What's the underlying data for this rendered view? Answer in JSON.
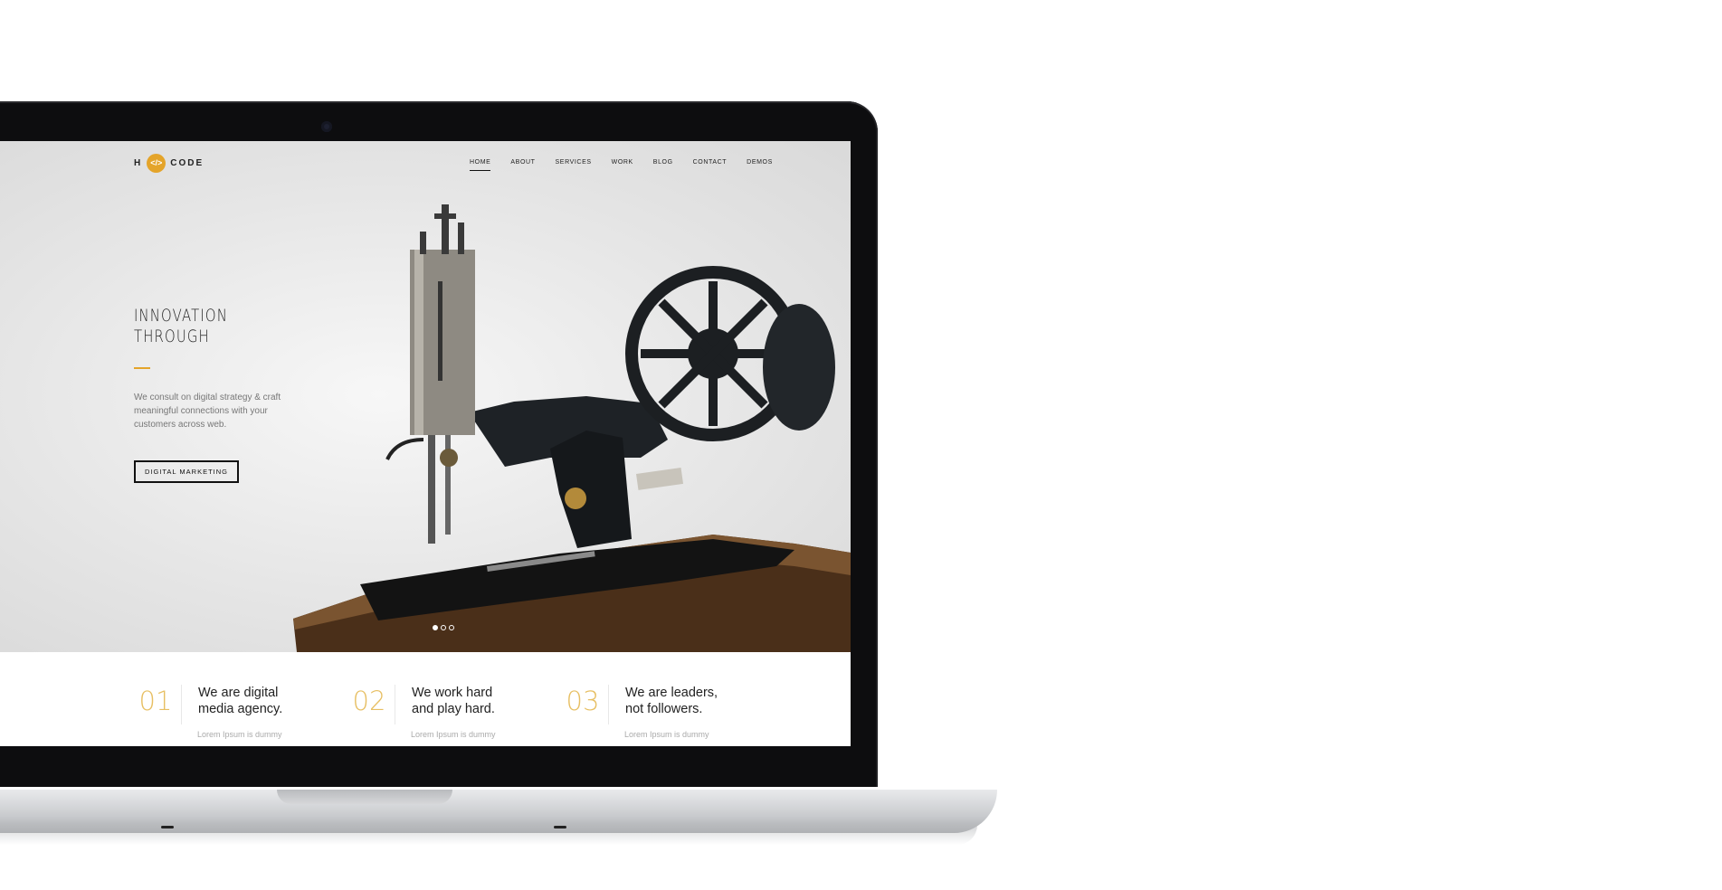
{
  "site": {
    "logo": {
      "left": "H",
      "badge": "</>",
      "right": "CODE"
    },
    "nav": [
      {
        "label": "HOME",
        "active": true
      },
      {
        "label": "ABOUT",
        "active": false
      },
      {
        "label": "SERVICES",
        "active": false
      },
      {
        "label": "WORK",
        "active": false
      },
      {
        "label": "BLOG",
        "active": false
      },
      {
        "label": "CONTACT",
        "active": false
      },
      {
        "label": "DEMOS",
        "active": false
      }
    ],
    "hero": {
      "headline_line1": "INNOVATION",
      "headline_line2": "THROUGH",
      "tagline": "We consult on digital strategy & craft meaningful connections with your customers across web.",
      "cta_label": "DIGITAL MARKETING",
      "slider": {
        "total": 3,
        "active_index": 0
      }
    },
    "features": [
      {
        "number": "01",
        "title": "We are digital media agency.",
        "subtitle": "Lorem Ipsum is dummy"
      },
      {
        "number": "02",
        "title": "We work hard and play hard.",
        "subtitle": "Lorem Ipsum is dummy"
      },
      {
        "number": "03",
        "title": "We are leaders, not followers.",
        "subtitle": "Lorem Ipsum is dummy"
      }
    ]
  },
  "colors": {
    "accent": "#e4a42a",
    "number": "#e7bf63",
    "bezel": "#0d0d0f"
  }
}
